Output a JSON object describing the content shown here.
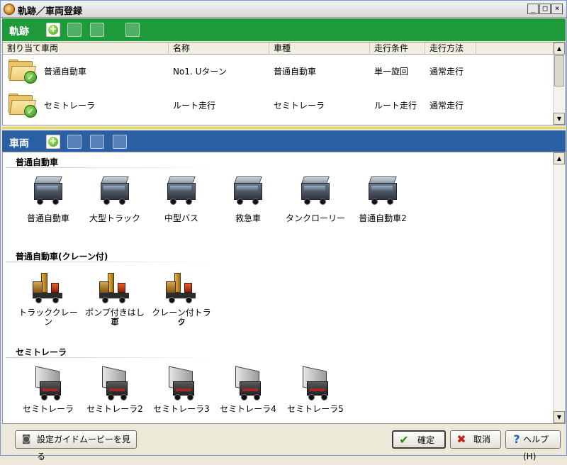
{
  "window": {
    "title": "軌跡／車両登録",
    "buttons": {
      "minimize": "_",
      "maximize": "□",
      "close": "×"
    }
  },
  "tracks_section": {
    "label": "軌跡",
    "header_color": "#1e9a3a",
    "columns": [
      "割り当て車両",
      "名称",
      "車種",
      "走行条件",
      "走行方法"
    ],
    "rows": [
      {
        "vehicle": "普通自動車",
        "name": "No1. Uターン",
        "type": "普通自動車",
        "condition": "単一旋回",
        "method": "通常走行"
      },
      {
        "vehicle": "セミトレーラ",
        "name": "ルート走行",
        "type": "セミトレーラ",
        "condition": "ルート走行",
        "method": "通常走行"
      }
    ]
  },
  "vehicles_section": {
    "label": "車両",
    "header_color": "#2a5fa3",
    "groups": [
      {
        "title": "普通自動車",
        "icon": "bus-icon",
        "items": [
          "普通自動車",
          "大型トラック",
          "中型バス",
          "救急車",
          "タンクローリー",
          "普通自動車2"
        ]
      },
      {
        "title": "普通自動車(クレーン付)",
        "icon": "crane-truck-icon",
        "items": [
          [
            "トラッククレーン"
          ],
          [
            "ポンプ付きはしご",
            "車"
          ],
          [
            "クレーン付トラッ",
            "ク"
          ]
        ]
      },
      {
        "title": "セミトレーラ",
        "icon": "semi-trailer-icon",
        "items": [
          "セミトレーラ",
          "セミトレーラ2",
          "セミトレーラ3",
          "セミトレーラ4",
          "セミトレーラ5"
        ]
      }
    ]
  },
  "footer": {
    "guide_button": "設定ガイドムービーを見る",
    "ok_button": "確定",
    "cancel_button": "取消",
    "help_button": "ヘルプ(H)"
  }
}
